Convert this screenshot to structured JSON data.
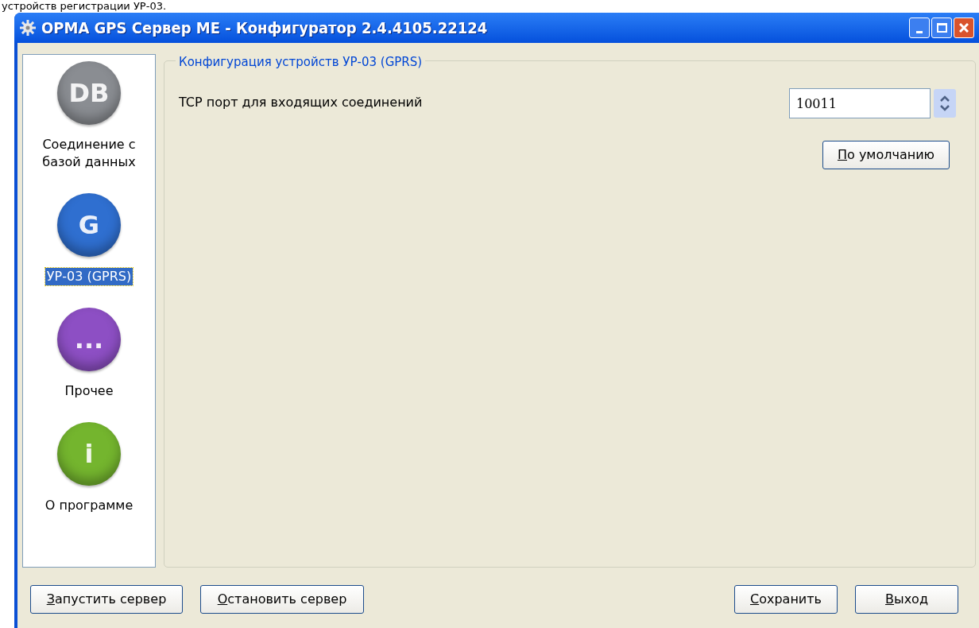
{
  "caption_above": "устройств регистрации УР-03.",
  "window": {
    "title": "ОРМА GPS Сервер ME - Конфигуратор 2.4.4105.22124"
  },
  "sidebar": {
    "items": [
      {
        "label": "Соединение с базой данных",
        "glyph": "DB",
        "color": "#8a8d92",
        "selected": false
      },
      {
        "label": "УР-03 (GPRS)",
        "glyph": "G",
        "color": "#2f6fd0",
        "selected": true
      },
      {
        "label": "Прочее",
        "glyph": "...",
        "color": "#8d4fc4",
        "selected": false
      },
      {
        "label": "О программе",
        "glyph": "i",
        "color": "#74b52e",
        "selected": false
      }
    ]
  },
  "group": {
    "title": "Конфигурация устройств УР-03 (GPRS)",
    "field_label": "TCP порт для входящих соединений",
    "port_value": "10011",
    "default_button": "По умолчанию"
  },
  "footer": {
    "left_buttons": [
      "Запустить сервер",
      "Остановить сервер"
    ],
    "right_buttons": [
      "Сохранить",
      "Выход"
    ]
  }
}
